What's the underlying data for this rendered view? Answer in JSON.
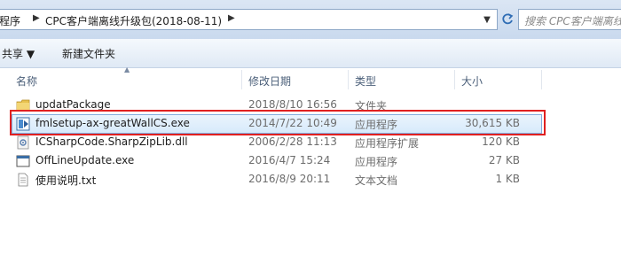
{
  "address": {
    "breadcrumb": [
      "程序",
      "CPC客户端离线升级包(2018-08-11)"
    ],
    "search_placeholder": "搜索 CPC客户端离线..."
  },
  "toolbar": {
    "share_label": "共享 ▼",
    "new_folder_label": "新建文件夹"
  },
  "columns": {
    "name": "名称",
    "modified": "修改日期",
    "type": "类型",
    "size": "大小"
  },
  "files": [
    {
      "name": "updatPackage",
      "modified": "2018/8/10 16:56",
      "type": "文件夹",
      "size": "",
      "icon": "folder-icon"
    },
    {
      "name": "fmlsetup-ax-greatWallCS.exe",
      "modified": "2014/7/22 10:49",
      "type": "应用程序",
      "size": "30,615 KB",
      "icon": "installer-icon"
    },
    {
      "name": "ICSharpCode.SharpZipLib.dll",
      "modified": "2006/2/28 11:13",
      "type": "应用程序扩展",
      "size": "120 KB",
      "icon": "dll-icon"
    },
    {
      "name": "OffLineUpdate.exe",
      "modified": "2016/4/7 15:24",
      "type": "应用程序",
      "size": "27 KB",
      "icon": "exe-window-icon"
    },
    {
      "name": "使用说明.txt",
      "modified": "2016/8/9 20:11",
      "type": "文本文档",
      "size": "1 KB",
      "icon": "text-file-icon"
    }
  ],
  "colors": {
    "highlight": "#e02020",
    "selection": "#d7eafb"
  }
}
